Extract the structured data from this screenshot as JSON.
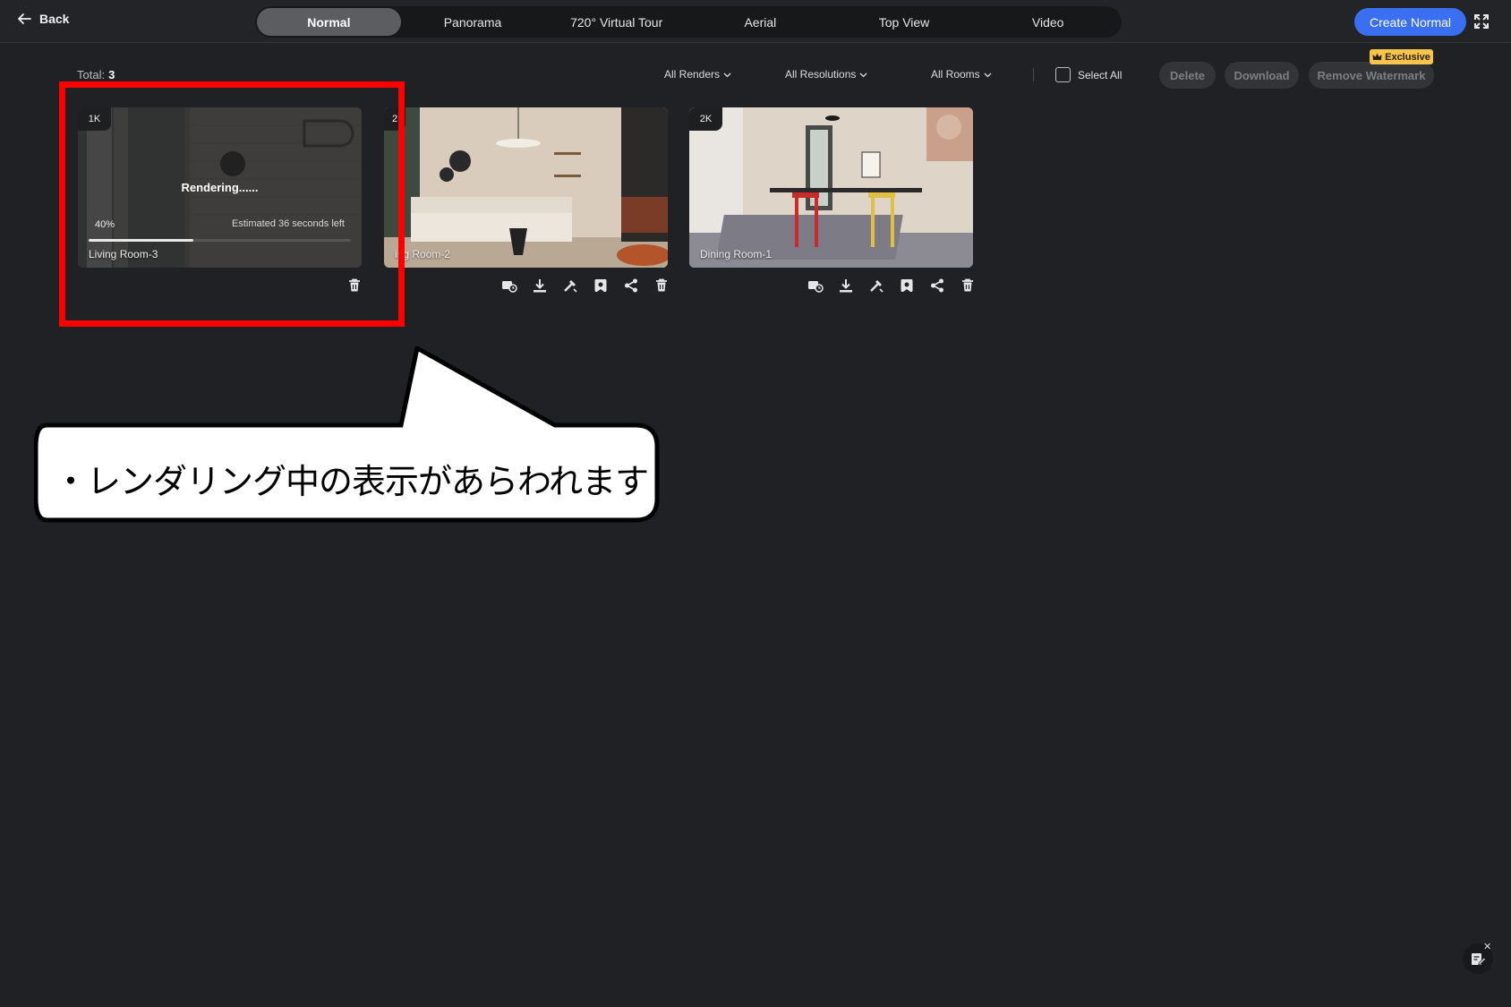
{
  "header": {
    "back_label": "Back",
    "tabs": [
      {
        "label": "Normal",
        "active": true
      },
      {
        "label": "Panorama"
      },
      {
        "label": "720° Virtual Tour"
      },
      {
        "label": "Aerial"
      },
      {
        "label": "Top View"
      },
      {
        "label": "Video"
      }
    ],
    "create_label": "Create Normal"
  },
  "toolbar": {
    "total_label": "Total:",
    "total_count": "3",
    "filters": [
      "All Renders",
      "All Resolutions",
      "All Rooms"
    ],
    "select_all_label": "Select All",
    "delete_label": "Delete",
    "download_label": "Download",
    "remove_watermark_label": "Remove Watermark",
    "exclusive_label": "Exclusive"
  },
  "renders": [
    {
      "resolution": "1K",
      "title": "Living Room-3",
      "status": "Rendering......",
      "progress_percent": "40%",
      "progress": 0.4,
      "estimate": "Estimated 36 seconds left"
    },
    {
      "resolution": "2",
      "title": "ing Room-2"
    },
    {
      "resolution": "2K",
      "title": "Dining Room-1"
    }
  ],
  "annotation": {
    "text": "・レンダリング中の表示があらわれます"
  },
  "colors": {
    "background": "#202124",
    "accent": "#3a6ff2",
    "highlight": "#ff0000",
    "exclusive": "#f7c54a"
  }
}
